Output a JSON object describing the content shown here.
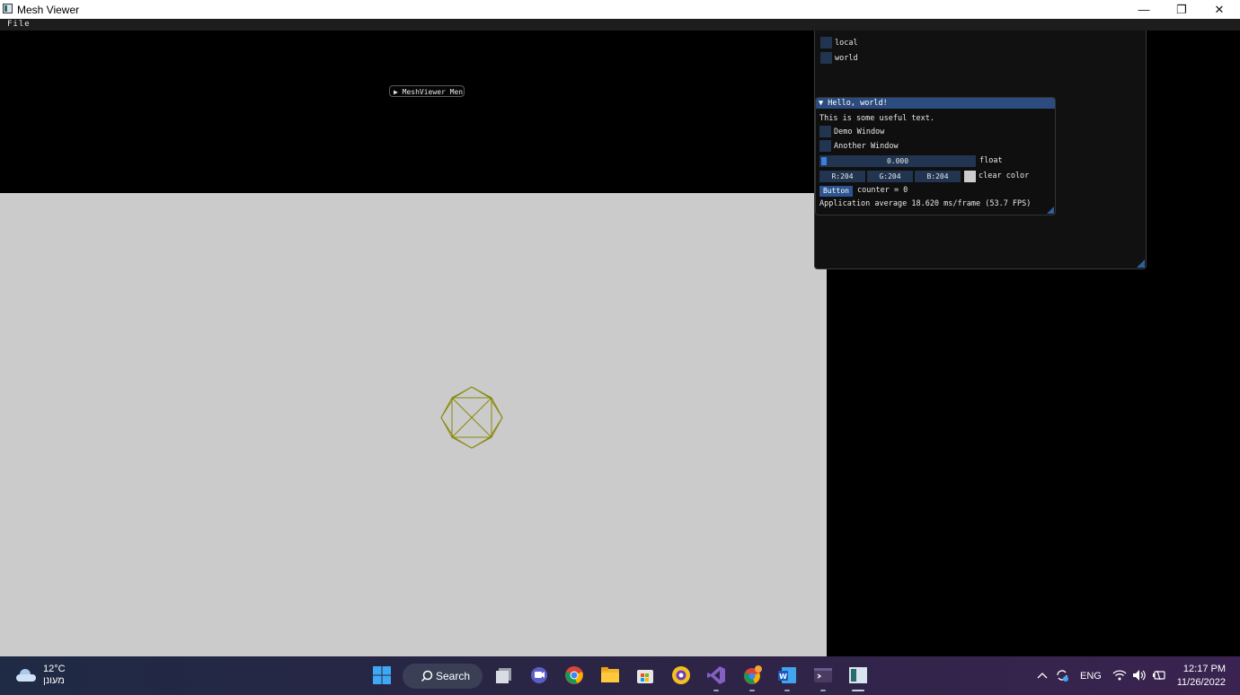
{
  "window": {
    "title": "Mesh Viewer",
    "controls": {
      "minimize": "—",
      "maximize": "❐",
      "close": "✕"
    }
  },
  "menu": {
    "file": "File"
  },
  "collapsed_window": {
    "arrow": "▶",
    "label": "MeshViewer Men"
  },
  "transform_panel": {
    "local_label": "local",
    "world_label": "world"
  },
  "hello_window": {
    "arrow": "▼",
    "title": "Hello, world!",
    "text": "This is some useful text.",
    "demo_window_label": "Demo Window",
    "another_window_label": "Another Window",
    "slider_value": "0.000",
    "slider_label": "float",
    "color_r": "R:204",
    "color_g": "G:204",
    "color_b": "B:204",
    "color_label": "clear color",
    "swatch_color": "#cccccc",
    "button_label": "Button",
    "counter_text": "counter = 0",
    "fps_text": "Application average 18.620 ms/frame (53.7 FPS)"
  },
  "viewport": {
    "background": "#cbcbcb",
    "mesh_color": "#8a8a10"
  },
  "taskbar": {
    "weather_temp": "12°C",
    "weather_desc": "מעונן",
    "search_label": "Search",
    "language": "ENG",
    "time": "12:17 PM",
    "date": "11/26/2022",
    "icons": [
      "windows-start-icon",
      "search-icon",
      "task-view-icon",
      "teams-chat-icon",
      "chrome-icon",
      "file-explorer-icon",
      "store-icon",
      "browser-icon",
      "visual-studio-icon",
      "chrome-profile-icon",
      "word-icon",
      "terminal-icon",
      "mesh-viewer-app-icon"
    ]
  }
}
